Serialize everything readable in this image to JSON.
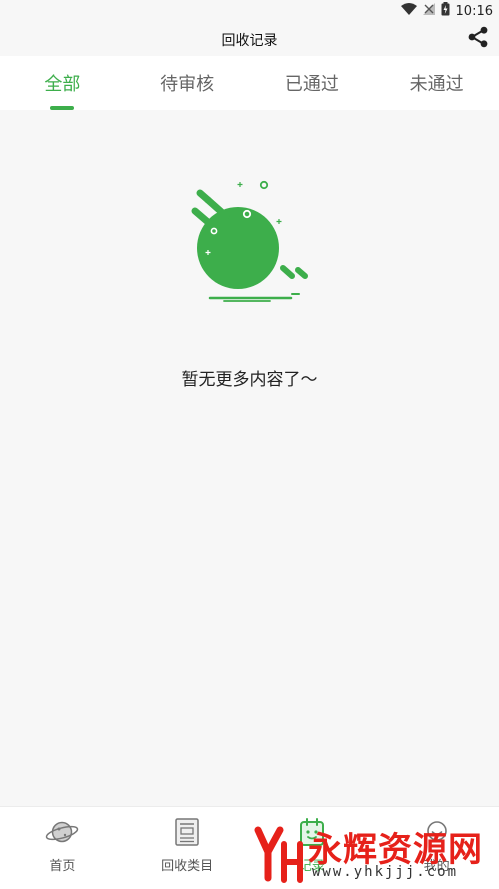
{
  "status_bar": {
    "time": "10:16"
  },
  "app_bar": {
    "title": "回收记录"
  },
  "tabs": [
    {
      "label": "全部",
      "active": true
    },
    {
      "label": "待审核",
      "active": false
    },
    {
      "label": "已通过",
      "active": false
    },
    {
      "label": "未通过",
      "active": false
    }
  ],
  "empty_state": {
    "message": "暂无更多内容了～"
  },
  "bottom_nav": [
    {
      "label": "首页",
      "icon": "planet-icon",
      "active": false
    },
    {
      "label": "回收类目",
      "icon": "category-icon",
      "active": false
    },
    {
      "label": "记录",
      "icon": "record-icon",
      "active": true
    },
    {
      "label": "我的",
      "icon": "profile-icon",
      "active": false
    }
  ],
  "watermark": {
    "text": "永辉资源网",
    "url": "www.yhkjjj.com"
  },
  "colors": {
    "accent": "#3dae4b",
    "background": "#f7f7f7",
    "watermark": "#e6211a"
  }
}
